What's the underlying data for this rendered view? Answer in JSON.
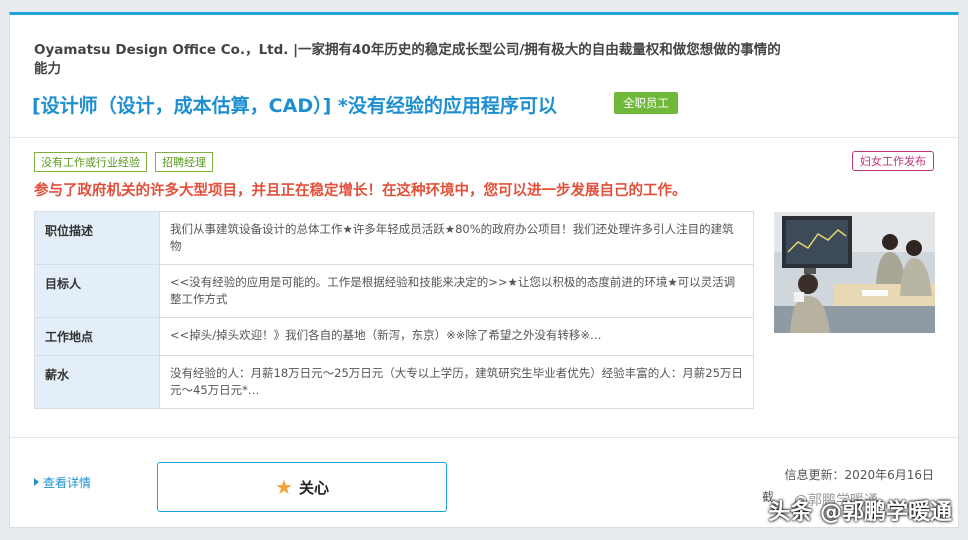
{
  "header": {
    "company": "Oyamatsu Design Office Co.，Ltd. |一家拥有40年历史的稳定成长型公司/拥有极大的自由裁量权和做您想做的事情的能力",
    "job_title": "[设计师（设计，成本估算，CAD）] *没有经验的应用程序可以",
    "employment_badge": "全职员工"
  },
  "tags": [
    "没有工作或行业经验",
    "招聘经理"
  ],
  "women_tag": "妇女工作发布",
  "catch_copy": "参与了政府机关的许多大型项目，并且正在稳定增长！在这种环境中，您可以进一步发展自己的工作。",
  "info_rows": [
    {
      "label": "职位描述",
      "value": "我们从事建筑设备设计的总体工作★许多年轻成员活跃★80%的政府办公项目！我们还处理许多引人注目的建筑物"
    },
    {
      "label": "目标人",
      "value": "<<没有经验的应用是可能的。工作是根据经验和技能来决定的>>★让您以积极的态度前进的环境★可以灵活调整工作方式"
    },
    {
      "label": "工作地点",
      "value": "<<掉头/掉头欢迎！》我们各自的基地（新泻，东京）※※除了希望之外没有转移※…"
    },
    {
      "label": "薪水",
      "value": "没有经验的人：月薪18万日元〜25万日元（大专以上学历，建筑研究生毕业者优先）经验丰富的人：月薪25万日元〜45万日元*…"
    }
  ],
  "footer": {
    "detail_link": "查看详情",
    "interest_button": "关心",
    "updated": "信息更新：2020年6月16日",
    "footnote_left": "截",
    "watermark_upper": "@郭鹏学暖通",
    "watermark": "头条 @郭鹏学暖通"
  },
  "colors": {
    "accent": "#21a6dc",
    "title_blue": "#1d8fd0",
    "badge_green": "#6fb83a",
    "catch_red": "#e2503a",
    "women_tag": "#c2347a"
  },
  "icons": {
    "star": "star-icon",
    "arrow": "triangle-right-icon"
  }
}
